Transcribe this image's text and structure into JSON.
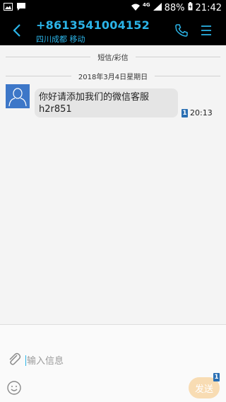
{
  "status_bar": {
    "network": "4G",
    "battery": "88%",
    "time": "21:42",
    "icons": [
      "image-icon",
      "message-icon",
      "wifi-icon",
      "signal-icon",
      "battery-icon"
    ]
  },
  "header": {
    "phone_number": "+8613541004152",
    "subtitle": "四川成都 移动",
    "accent_color": "#2bb4e8"
  },
  "conversation": {
    "section_label": "短信/彩信",
    "date_label": "2018年3月4日星期日",
    "messages": [
      {
        "text_line1": "你好请添加我们的微信客服",
        "text_line2": "h2r851",
        "sim": "1",
        "time": "20:13"
      }
    ]
  },
  "composer": {
    "placeholder": "输入信息",
    "send_label": "发送",
    "send_sim": "1",
    "send_color": "#f8dcb3"
  }
}
